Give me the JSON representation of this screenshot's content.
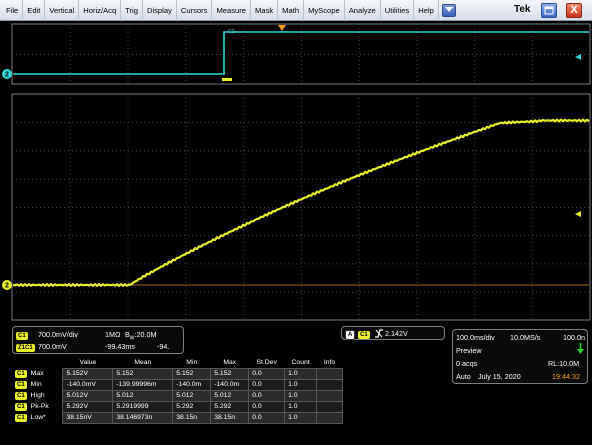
{
  "menubar": {
    "items": [
      "File",
      "Edit",
      "Vertical",
      "Horiz/Acq",
      "Trig",
      "Display",
      "Cursors",
      "Measure",
      "Mask",
      "Math",
      "MyScope",
      "Analyze",
      "Utilities",
      "Help"
    ],
    "brand": "Tek",
    "close_glyph": "X"
  },
  "waveform": {
    "ch1_color": "#e8f02a",
    "ch2_color": "#2fd6d6",
    "ref_marker_label": "2",
    "ch2_trace_label": "C2"
  },
  "channel_panel": {
    "ch1_badge": "C1",
    "ch1_scale": "700.0mV/div",
    "ch1_coupling": "1MΩ",
    "ch1_bw_b": "B",
    "ch1_bw_sub": "W",
    "ch1_bw_val": ":20.0M",
    "zoom_badge": "Z1C1",
    "zoom_scale": "700.0mV",
    "zoom_pos": "-99.43ms",
    "zoom_extra": "-94."
  },
  "trigger": {
    "mode_badge": "A",
    "source_badge": "C1",
    "slope_icon": "rising-edge-icon",
    "level": "2.142V"
  },
  "horizontal": {
    "timebase": "100.0ms/div",
    "sample_rate": "10.0MS/s",
    "record_partial": "100.0n",
    "state": "Preview",
    "acqs": "0 acqs",
    "record_length": "RL:10.0M",
    "mode": "Auto",
    "date": "July 15, 2020",
    "time": "19:44:32"
  },
  "measurements": {
    "headers": [
      "",
      "Value",
      "Mean",
      "Min",
      "Max",
      "St Dev",
      "Count",
      "Info"
    ],
    "rows": [
      {
        "badge": "C1",
        "label": "Max",
        "value": "5.152V",
        "mean": "5.152",
        "min": "5.152",
        "max": "5.152",
        "stdev": "0.0",
        "count": "1.0"
      },
      {
        "badge": "C1",
        "label": "Min",
        "value": "-140.0mV",
        "mean": "-139.99996m",
        "min": "-140.0m",
        "max": "-140.0m",
        "stdev": "0.0",
        "count": "1.0"
      },
      {
        "badge": "C1",
        "label": "High",
        "value": "5.012V",
        "mean": "5.012",
        "min": "5.012",
        "max": "5.012",
        "stdev": "0.0",
        "count": "1.0"
      },
      {
        "badge": "C1",
        "label": "Pk-Pk",
        "value": "5.292V",
        "mean": "5.2919999",
        "min": "5.292",
        "max": "5.292",
        "stdev": "0.0",
        "count": "1.0"
      },
      {
        "badge": "C1",
        "label": "Low*",
        "value": "38.15nV",
        "mean": "38.146973n",
        "min": "38.15n",
        "max": "38.15n",
        "stdev": "0.0",
        "count": "1.0"
      }
    ]
  }
}
